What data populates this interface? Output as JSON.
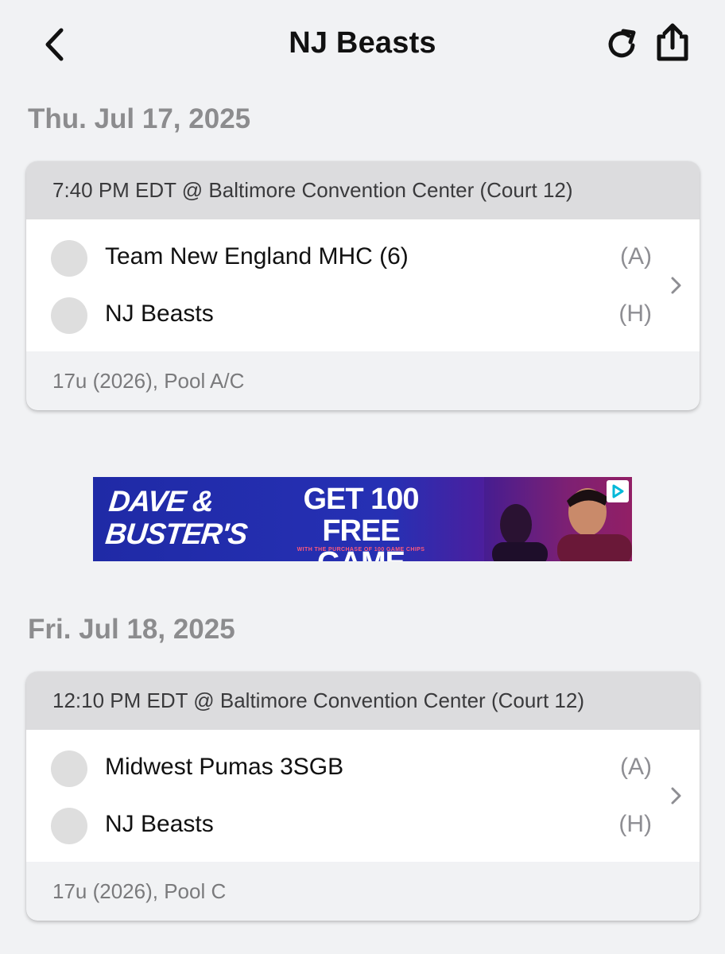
{
  "header": {
    "title": "NJ Beasts",
    "back_icon": "chevron-left-icon",
    "refresh_icon": "refresh-icon",
    "share_icon": "share-icon"
  },
  "days": [
    {
      "date": "Thu. Jul 17, 2025",
      "game": {
        "time_location": "7:40 PM EDT @ Baltimore Convention Center (Court 12)",
        "teams": [
          {
            "name": "Team New England MHC (6)",
            "side": "(A)"
          },
          {
            "name": "NJ Beasts",
            "side": "(H)"
          }
        ],
        "division": "17u (2026), Pool A/C"
      }
    },
    {
      "date": "Fri. Jul 18, 2025",
      "game": {
        "time_location": "12:10 PM EDT @ Baltimore Convention Center (Court 12)",
        "teams": [
          {
            "name": "Midwest Pumas 3SGB",
            "side": "(A)"
          },
          {
            "name": "NJ Beasts",
            "side": "(H)"
          }
        ],
        "division": "17u (2026), Pool C"
      }
    }
  ],
  "ad": {
    "brand_line1": "DAVE &",
    "brand_line2": "BUSTER'S",
    "headline_line1": "GET 100 FREE",
    "headline_line2": "GAME CHIPS",
    "fine_print": "WITH THE PURCHASE OF 100 GAME CHIPS",
    "colors": {
      "background": "#2630b4",
      "accent": "#c2235a",
      "badge": "#00b8d9"
    }
  }
}
